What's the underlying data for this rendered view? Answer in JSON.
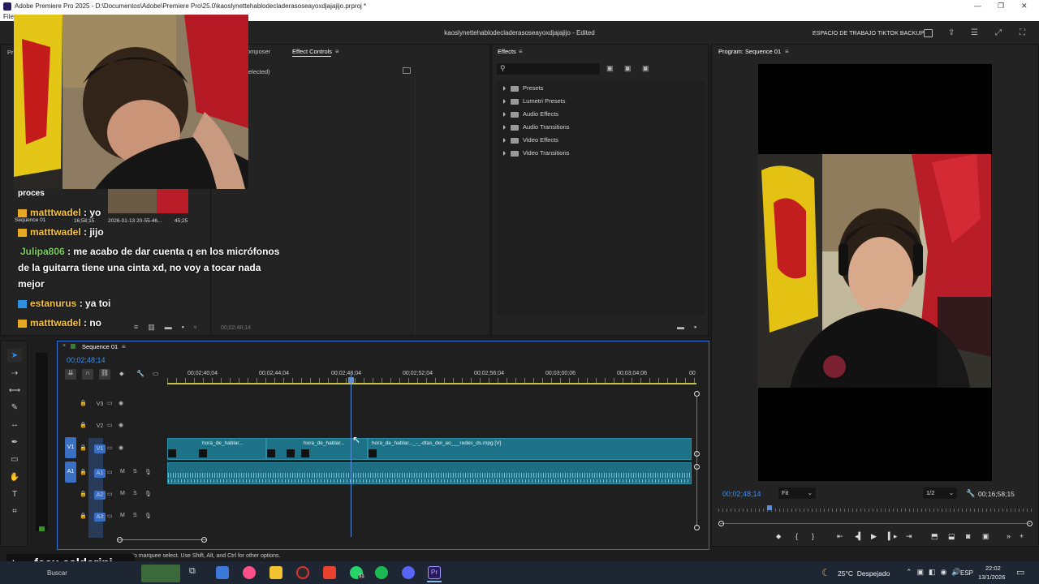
{
  "window": {
    "title": "Adobe Premiere Pro 2025 - D:\\Documentos\\Adobe\\Premiere Pro\\25.0\\kaoslynettehablodecladerasoseayoxdjajajijo.prproj *",
    "menu_first": "File"
  },
  "header": {
    "project_title": "kaoslynettehablodecladerasoseayoxdjajajijo - Edited",
    "workspace": "ESPACIO DE TRABAJO TIKTOK BACKUP"
  },
  "source_panel": {
    "tabs": [
      "Pr",
      "omposer",
      "Effect Controls"
    ],
    "no_clip": "elected)",
    "timecode": "00;02;48;14"
  },
  "effects_panel": {
    "tab": "Effects",
    "search_placeholder": "",
    "items": [
      "Presets",
      "Lumetri Presets",
      "Audio Effects",
      "Audio Transitions",
      "Video Effects",
      "Video Transitions"
    ]
  },
  "program_monitor": {
    "tab": "Program: Sequence 01",
    "timecode": "00;02;48;14",
    "fit": "Fit",
    "resolution": "1/2",
    "duration": "00;16;58;15"
  },
  "chat_overlay": {
    "cut_line": "proces",
    "sequence_label": "Sequence 01",
    "meta_time": "16;58;15",
    "meta_date": "2026-01-13 20-55-46...",
    "meta_dur": "45;25",
    "messages": [
      {
        "user": "matttwadel",
        "text": " : yo",
        "badge": "crown",
        "color": "gold"
      },
      {
        "user": "matttwadel",
        "text": " : jijo",
        "badge": "crown",
        "color": "gold"
      },
      {
        "user": "Julipa806",
        "text": " : me acabo de dar cuenta q en los micrófonos",
        "badge": "",
        "color": "green"
      },
      {
        "user": "",
        "text": "de la guitarra tiene una cinta xd, no voy a tocar nada",
        "badge": "",
        "color": "white"
      },
      {
        "user": "",
        "text": "mejor",
        "badge": "",
        "color": "white"
      },
      {
        "user": "estanurus",
        "text": " : ya toi",
        "badge": "blue",
        "color": "gold"
      },
      {
        "user": "matttwadel",
        "text": " : no",
        "badge": "crown",
        "color": "gold"
      }
    ]
  },
  "timeline": {
    "tab": "Sequence 01",
    "timecode": "00;02;48;14",
    "ruler": [
      "00;02;40;04",
      "00;02;44;04",
      "00;02;48;04",
      "00;02;52;04",
      "00;02;56;04",
      "00;03;00;06",
      "00;03;04;06",
      "00"
    ],
    "tracks": [
      "V3",
      "V2",
      "V1",
      "A1",
      "A2",
      "A3"
    ],
    "source_labels": [
      "V1",
      "A1"
    ],
    "clips": [
      "hora_de_hablar...",
      "hora_de_hablar...",
      "hora_de_hablar..._-_-dtas_del_ao___redes_ds.mpg [V]"
    ]
  },
  "status_bar": {
    "hint": "to marquee select. Use Shift, Alt, and Ctrl for other options."
  },
  "tiktok_watermark": "facu.calderini",
  "taskbar": {
    "search": "Buscar",
    "weather": "25°C  Despejado",
    "lang": "ESP",
    "time": "22:02",
    "date": "13/1/2026",
    "whatsapp_badge": "91"
  },
  "colors": {
    "accent_blue": "#2d8ceb",
    "clip_teal": "#1d7287",
    "playhead": "#5a8fd8"
  }
}
